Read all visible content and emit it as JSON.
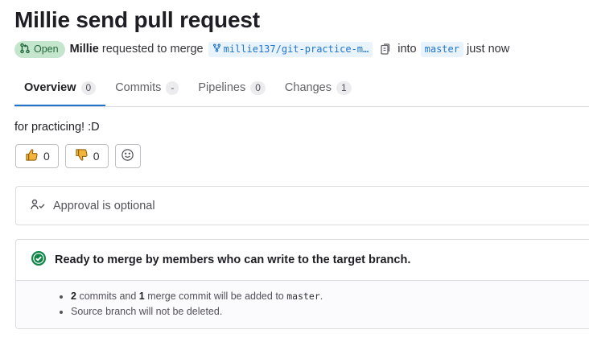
{
  "title": "Millie send pull request",
  "status": {
    "label": "Open",
    "color": "#24663b",
    "bg": "#c3e6cd"
  },
  "meta": {
    "author": "Millie",
    "requested_text": "requested to merge",
    "source_branch": "millie137/git-practice-m…",
    "into_text": "into",
    "target_branch": "master",
    "time_text": "just now"
  },
  "tabs": [
    {
      "label": "Overview",
      "count": "0",
      "active": true
    },
    {
      "label": "Commits",
      "count": "-"
    },
    {
      "label": "Pipelines",
      "count": "0"
    },
    {
      "label": "Changes",
      "count": "1"
    }
  ],
  "description": "for practicing! :D",
  "reactions": {
    "thumbs_up_count": "0",
    "thumbs_down_count": "0"
  },
  "approval": {
    "text": "Approval is optional"
  },
  "merge": {
    "heading": "Ready to merge by members who can write to the target branch.",
    "line1": {
      "commits": "2",
      "commits_text": "commits and",
      "merge_commits": "1",
      "merge_text": "merge commit will be added to",
      "branch": "master",
      "end": "."
    },
    "line2": "Source branch will not be deleted."
  },
  "colors": {
    "accent": "#1f75cb",
    "success": "#108548"
  },
  "icons": [
    "merge-request-icon",
    "branch-icon",
    "copy-icon",
    "thumbs-up-icon",
    "thumbs-down-icon",
    "smiley-icon",
    "approval-icon",
    "check-circle-icon"
  ]
}
